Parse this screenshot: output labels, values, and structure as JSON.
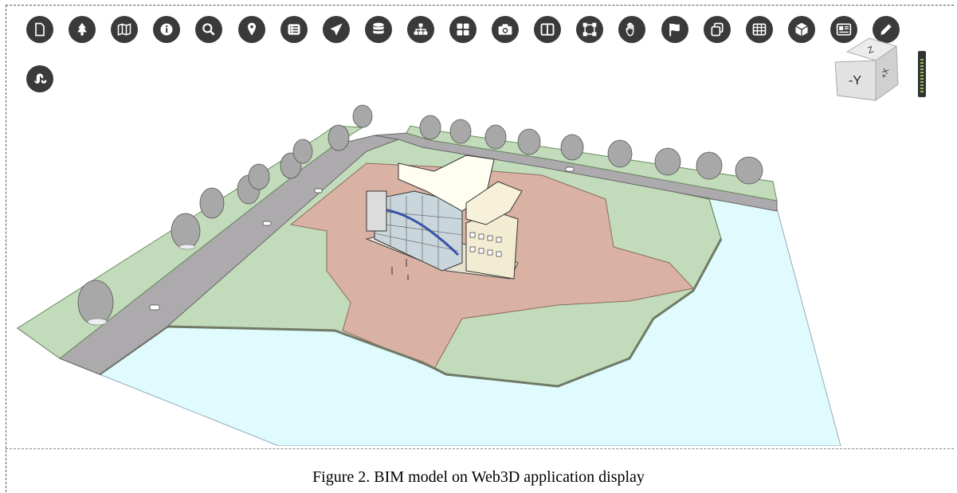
{
  "toolbar": {
    "tools": [
      {
        "name": "file-icon"
      },
      {
        "name": "tree-icon"
      },
      {
        "name": "map-icon"
      },
      {
        "name": "info-icon"
      },
      {
        "name": "search-icon"
      },
      {
        "name": "location-pin-icon"
      },
      {
        "name": "list-icon"
      },
      {
        "name": "send-icon"
      },
      {
        "name": "database-icon"
      },
      {
        "name": "hierarchy-icon"
      },
      {
        "name": "grid-icon"
      },
      {
        "name": "camera-icon"
      },
      {
        "name": "split-view-icon"
      },
      {
        "name": "bounding-box-icon"
      },
      {
        "name": "hand-icon"
      },
      {
        "name": "flag-icon"
      },
      {
        "name": "copy-icon"
      },
      {
        "name": "table-icon"
      },
      {
        "name": "cube-icon"
      },
      {
        "name": "newspaper-icon"
      },
      {
        "name": "pencil-icon"
      },
      {
        "name": "stumbleupon-icon"
      }
    ]
  },
  "nav_cube": {
    "front_label": "-Y",
    "top_label": "Z",
    "side_label": "+X"
  },
  "caption": {
    "text": "Figure 2. BIM model on Web3D application display"
  }
}
